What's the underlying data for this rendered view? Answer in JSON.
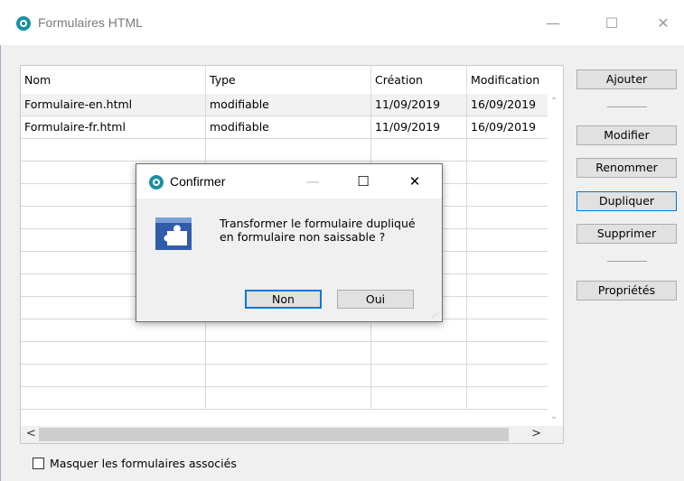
{
  "window": {
    "title": "Formulaires HTML",
    "controls": {
      "minimize": "—",
      "maximize": "☐",
      "close": "✕"
    }
  },
  "table": {
    "columns": [
      "Nom",
      "Type",
      "Création",
      "Modification"
    ],
    "rows": [
      [
        "Formulaire-en.html",
        "modifiable",
        "11/09/2019",
        "16/09/2019"
      ],
      [
        "Formulaire-fr.html",
        "modifiable",
        "11/09/2019",
        "16/09/2019"
      ]
    ],
    "scroll": {
      "up": "⌃",
      "down": "⌄",
      "left": "<",
      "right": ">"
    }
  },
  "buttons": {
    "ajouter": "Ajouter",
    "modifier": "Modifier",
    "renommer": "Renommer",
    "dupliquer": "Dupliquer",
    "supprimer": "Supprimer",
    "proprietes": "Propriétés"
  },
  "checkbox": {
    "label": "Masquer les formulaires associés",
    "checked": false
  },
  "dialog": {
    "title": "Confirmer",
    "message_line1": "Transformer le formulaire dupliqué",
    "message_line2": "en formulaire non saissable ?",
    "no": "Non",
    "yes": "Oui",
    "controls": {
      "minimize": "—",
      "maximize": "☐",
      "close": "✕"
    },
    "icon": "puzzle-window-icon"
  },
  "colors": {
    "accent": "#0078d7",
    "logo": "#1a8fa3",
    "dialog_icon": "#2f5da8"
  }
}
